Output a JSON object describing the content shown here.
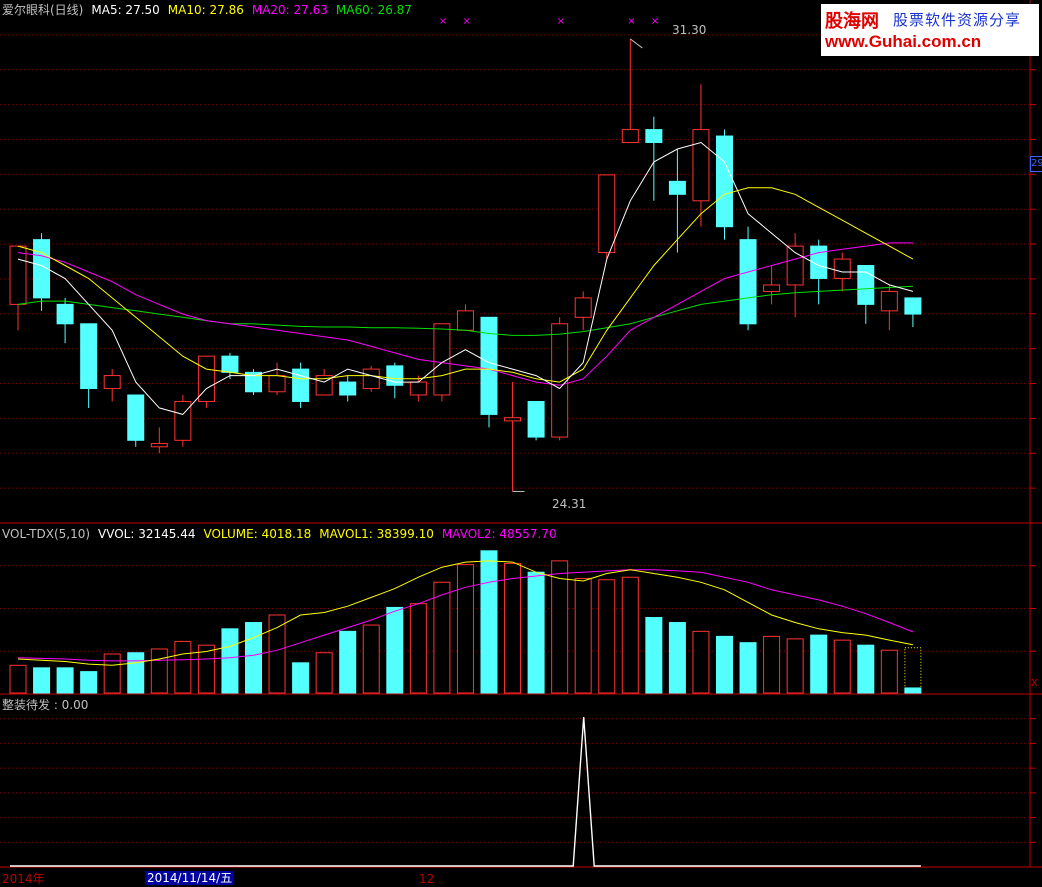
{
  "header": {
    "main": [
      {
        "text": "爱尔眼科(日线)",
        "color": "#c0c0c0"
      },
      {
        "text": "MA5: 27.50",
        "color": "#ffffff"
      },
      {
        "text": "MA10: 27.86",
        "color": "#ffff00"
      },
      {
        "text": "MA20: 27.63",
        "color": "#ff00ff"
      },
      {
        "text": "MA60: 26.87",
        "color": "#00e000"
      }
    ],
    "volume": [
      {
        "text": "VOL-TDX(5,10)",
        "color": "#c0c0c0"
      },
      {
        "text": "VVOL: 32145.44",
        "color": "#ffffff"
      },
      {
        "text": "VOLUME: 4018.18",
        "color": "#ffff00"
      },
      {
        "text": "MAVOL1: 38399.10",
        "color": "#ffff00"
      },
      {
        "text": "MAVOL2: 48557.70",
        "color": "#ff00ff"
      }
    ],
    "indicator": [
      {
        "text": "整装待发 : 0.00",
        "color": "#c0c0c0"
      }
    ]
  },
  "annotations": {
    "high": "31.30",
    "low": "24.31"
  },
  "scale_tag": "29",
  "x_tag": "X",
  "axis": {
    "year": "2014年",
    "cursor_date": "2014/11/14/五",
    "month": "12"
  },
  "watermark": {
    "logo": "股海网",
    "slogan": "股票软件资源分享",
    "url": "www.Guhai.com.cn"
  },
  "colors": {
    "up": "#ff3232",
    "down": "#54ffff",
    "grid": "#800000",
    "ma5": "#ffffff",
    "ma10": "#ffff00",
    "ma20": "#ff00ff",
    "ma60": "#00e000"
  },
  "chart_data": {
    "type": "candlestick",
    "title": "爱尔眼科(日线)",
    "price_range": [
      23.9,
      31.5
    ],
    "candles": [
      {
        "o": 27.2,
        "h": 27.7,
        "l": 26.8,
        "c": 28.1,
        "v": 22000
      },
      {
        "o": 28.2,
        "h": 28.3,
        "l": 27.1,
        "c": 27.3,
        "v": 20000
      },
      {
        "o": 27.2,
        "h": 27.3,
        "l": 26.6,
        "c": 26.9,
        "v": 20000
      },
      {
        "o": 26.9,
        "h": 26.9,
        "l": 25.6,
        "c": 25.9,
        "v": 17000
      },
      {
        "o": 25.9,
        "h": 26.2,
        "l": 25.7,
        "c": 26.1,
        "v": 31000
      },
      {
        "o": 25.8,
        "h": 25.8,
        "l": 25.0,
        "c": 25.1,
        "v": 32000
      },
      {
        "o": 25.0,
        "h": 25.3,
        "l": 24.9,
        "c": 25.05,
        "v": 35000
      },
      {
        "o": 25.1,
        "h": 25.8,
        "l": 25.0,
        "c": 25.7,
        "v": 41000
      },
      {
        "o": 25.7,
        "h": 26.4,
        "l": 25.6,
        "c": 26.4,
        "v": 38000
      },
      {
        "o": 26.4,
        "h": 26.45,
        "l": 26.05,
        "c": 26.15,
        "v": 51000
      },
      {
        "o": 26.15,
        "h": 26.2,
        "l": 25.8,
        "c": 25.85,
        "v": 56000
      },
      {
        "o": 25.85,
        "h": 26.3,
        "l": 25.8,
        "c": 26.1,
        "v": 62000
      },
      {
        "o": 26.2,
        "h": 26.3,
        "l": 25.6,
        "c": 25.7,
        "v": 24000
      },
      {
        "o": 25.8,
        "h": 26.2,
        "l": 25.8,
        "c": 26.1,
        "v": 32000
      },
      {
        "o": 26.0,
        "h": 26.1,
        "l": 25.7,
        "c": 25.8,
        "v": 49000
      },
      {
        "o": 25.9,
        "h": 26.25,
        "l": 25.85,
        "c": 26.2,
        "v": 54000
      },
      {
        "o": 26.25,
        "h": 26.3,
        "l": 25.75,
        "c": 25.95,
        "v": 68000
      },
      {
        "o": 25.8,
        "h": 26.1,
        "l": 25.7,
        "c": 26.0,
        "v": 71000
      },
      {
        "o": 25.8,
        "h": 26.2,
        "l": 25.7,
        "c": 26.9,
        "v": 88000
      },
      {
        "o": 26.8,
        "h": 27.2,
        "l": 26.9,
        "c": 27.1,
        "v": 102000
      },
      {
        "o": 27.0,
        "h": 27.0,
        "l": 25.3,
        "c": 25.5,
        "v": 113000
      },
      {
        "o": 25.4,
        "h": 26.0,
        "l": 24.31,
        "c": 25.45,
        "v": 103000
      },
      {
        "o": 25.7,
        "h": 25.7,
        "l": 25.1,
        "c": 25.15,
        "v": 96000
      },
      {
        "o": 25.15,
        "h": 27.0,
        "l": 25.1,
        "c": 26.9,
        "v": 105000
      },
      {
        "o": 27.0,
        "h": 27.4,
        "l": 26.8,
        "c": 27.3,
        "v": 91000
      },
      {
        "o": 28.0,
        "h": 29.2,
        "l": 27.9,
        "c": 29.2,
        "v": 90000
      },
      {
        "o": 29.7,
        "h": 31.3,
        "l": 29.7,
        "c": 29.9,
        "v": 92000
      },
      {
        "o": 29.9,
        "h": 30.1,
        "l": 28.8,
        "c": 29.7,
        "v": 60000
      },
      {
        "o": 29.1,
        "h": 29.6,
        "l": 28.0,
        "c": 28.9,
        "v": 56000
      },
      {
        "o": 28.8,
        "h": 30.6,
        "l": 28.4,
        "c": 29.9,
        "v": 49000
      },
      {
        "o": 29.8,
        "h": 29.9,
        "l": 28.2,
        "c": 28.4,
        "v": 45000
      },
      {
        "o": 28.2,
        "h": 28.4,
        "l": 26.8,
        "c": 26.9,
        "v": 40000
      },
      {
        "o": 27.4,
        "h": 27.8,
        "l": 27.2,
        "c": 27.5,
        "v": 45000
      },
      {
        "o": 27.5,
        "h": 28.3,
        "l": 27.0,
        "c": 28.1,
        "v": 43000
      },
      {
        "o": 28.1,
        "h": 28.2,
        "l": 27.2,
        "c": 27.6,
        "v": 46000
      },
      {
        "o": 27.6,
        "h": 28.0,
        "l": 27.4,
        "c": 27.9,
        "v": 42000
      },
      {
        "o": 27.8,
        "h": 27.8,
        "l": 26.9,
        "c": 27.2,
        "v": 38000
      },
      {
        "o": 27.1,
        "h": 27.5,
        "l": 26.8,
        "c": 27.4,
        "v": 34000
      },
      {
        "o": 27.3,
        "h": 27.3,
        "l": 26.85,
        "c": 27.05,
        "v": 4018
      }
    ],
    "ma5": [
      27.9,
      27.8,
      27.6,
      27.2,
      26.8,
      26.0,
      25.6,
      25.5,
      25.9,
      26.1,
      26.1,
      26.2,
      26.1,
      26.0,
      26.2,
      26.1,
      26.0,
      26.0,
      26.3,
      26.5,
      26.3,
      26.2,
      26.1,
      25.9,
      26.3,
      27.9,
      28.8,
      29.4,
      29.6,
      29.7,
      29.4,
      28.6,
      28.3,
      28.0,
      27.8,
      27.7,
      27.7,
      27.5,
      27.4
    ],
    "ma10": [
      28.1,
      28.0,
      27.8,
      27.6,
      27.3,
      27.0,
      26.7,
      26.4,
      26.2,
      26.15,
      26.1,
      26.1,
      26.05,
      26.05,
      26.1,
      26.1,
      26.05,
      26.05,
      26.1,
      26.2,
      26.2,
      26.15,
      26.05,
      26.0,
      26.2,
      26.8,
      27.3,
      27.8,
      28.2,
      28.6,
      28.9,
      29.0,
      29.0,
      28.9,
      28.7,
      28.5,
      28.3,
      28.1,
      27.9
    ],
    "ma20": [
      28.0,
      27.95,
      27.85,
      27.7,
      27.55,
      27.35,
      27.2,
      27.05,
      26.95,
      26.9,
      26.85,
      26.8,
      26.75,
      26.7,
      26.65,
      26.55,
      26.45,
      26.35,
      26.3,
      26.25,
      26.2,
      26.1,
      26.0,
      25.95,
      26.05,
      26.4,
      26.8,
      27.0,
      27.2,
      27.4,
      27.6,
      27.7,
      27.8,
      27.9,
      28.0,
      28.05,
      28.1,
      28.15,
      28.15
    ],
    "ma60": [
      27.2,
      27.25,
      27.25,
      27.2,
      27.15,
      27.1,
      27.05,
      27.0,
      26.95,
      26.9,
      26.9,
      26.88,
      26.86,
      26.85,
      26.85,
      26.84,
      26.84,
      26.83,
      26.82,
      26.8,
      26.75,
      26.72,
      26.72,
      26.74,
      26.78,
      26.84,
      26.9,
      27.0,
      27.1,
      27.2,
      27.25,
      27.3,
      27.35,
      27.38,
      27.4,
      27.42,
      27.44,
      27.46,
      27.48
    ],
    "mavol1": [
      27000,
      26000,
      25000,
      23000,
      22000,
      24000,
      27000,
      31000,
      33000,
      37000,
      44000,
      52000,
      62000,
      64000,
      69000,
      76000,
      83000,
      92000,
      100000,
      104000,
      105000,
      104000,
      96000,
      91000,
      89000,
      95000,
      98000,
      95000,
      92000,
      88000,
      82000,
      72000,
      62000,
      56000,
      51000,
      48000,
      46000,
      42000,
      38399
    ],
    "mavol2": [
      28000,
      27500,
      27000,
      26000,
      25500,
      25500,
      26000,
      26500,
      27000,
      28000,
      30000,
      34000,
      40000,
      46000,
      52000,
      58000,
      65000,
      71000,
      78000,
      84000,
      88000,
      91000,
      93000,
      95000,
      96000,
      97000,
      98000,
      98000,
      97000,
      96000,
      92000,
      88000,
      82000,
      78000,
      74000,
      69000,
      63000,
      56000,
      48557.7
    ],
    "indicator": {
      "values": [
        0,
        0,
        0,
        0,
        0,
        0,
        0,
        0,
        0,
        0,
        0,
        0,
        0,
        0,
        0,
        0,
        0,
        0,
        0,
        0,
        0,
        0,
        0,
        0,
        1,
        0,
        0,
        0,
        0,
        0,
        0,
        0,
        0,
        0,
        0,
        0,
        0,
        0,
        0
      ],
      "value": 0.0
    },
    "signal_markers": [
      18,
      19,
      23,
      26,
      27
    ]
  }
}
